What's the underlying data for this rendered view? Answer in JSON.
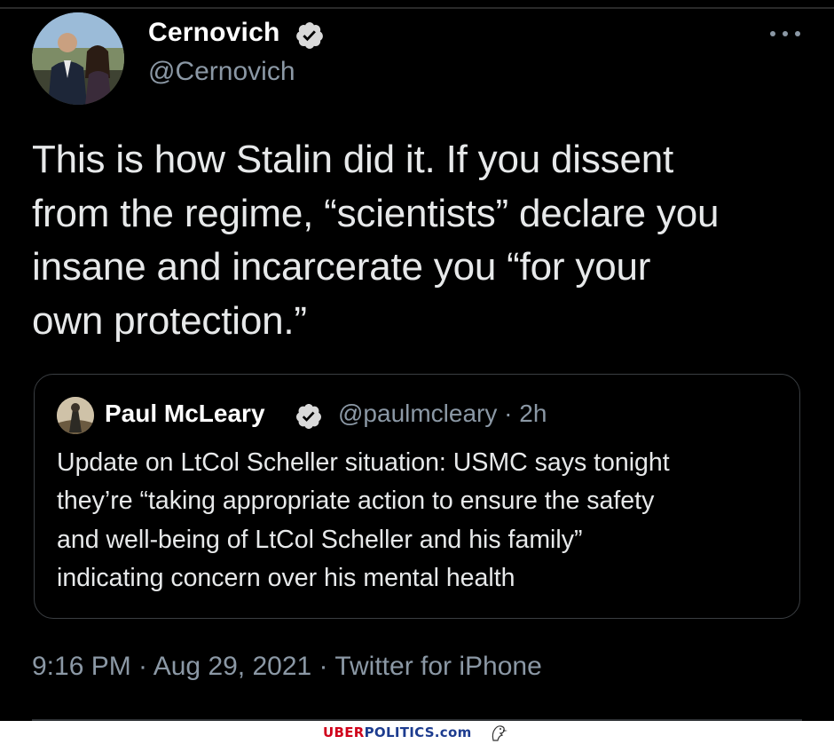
{
  "tweet": {
    "author": {
      "name": "Cernovich",
      "handle": "@Cernovich"
    },
    "text_lines": [
      "This is how Stalin did it. If you dissent",
      "from the regime, “scientists” declare you",
      "insane and incarcerate you “for your",
      "own protection.”"
    ],
    "timestamp": "9:16 PM · Aug 29, 2021 · Twitter for iPhone"
  },
  "quote": {
    "author_name": "Paul McLeary",
    "handle_time": "@paulmcleary · 2h",
    "text_lines": [
      "Update on LtCol Scheller situation: USMC says tonight",
      "they’re “taking appropriate action to ensure the safety",
      "and well-being of LtCol Scheller and his family”",
      "indicating concern over his mental health"
    ]
  },
  "watermark": {
    "part1": "UBER",
    "part2": "POLITICS.com"
  },
  "colors": {
    "background": "#000000",
    "text": "#e7e9ea",
    "secondary": "#8b98a5",
    "verified_badge": "#d9d9d9"
  }
}
